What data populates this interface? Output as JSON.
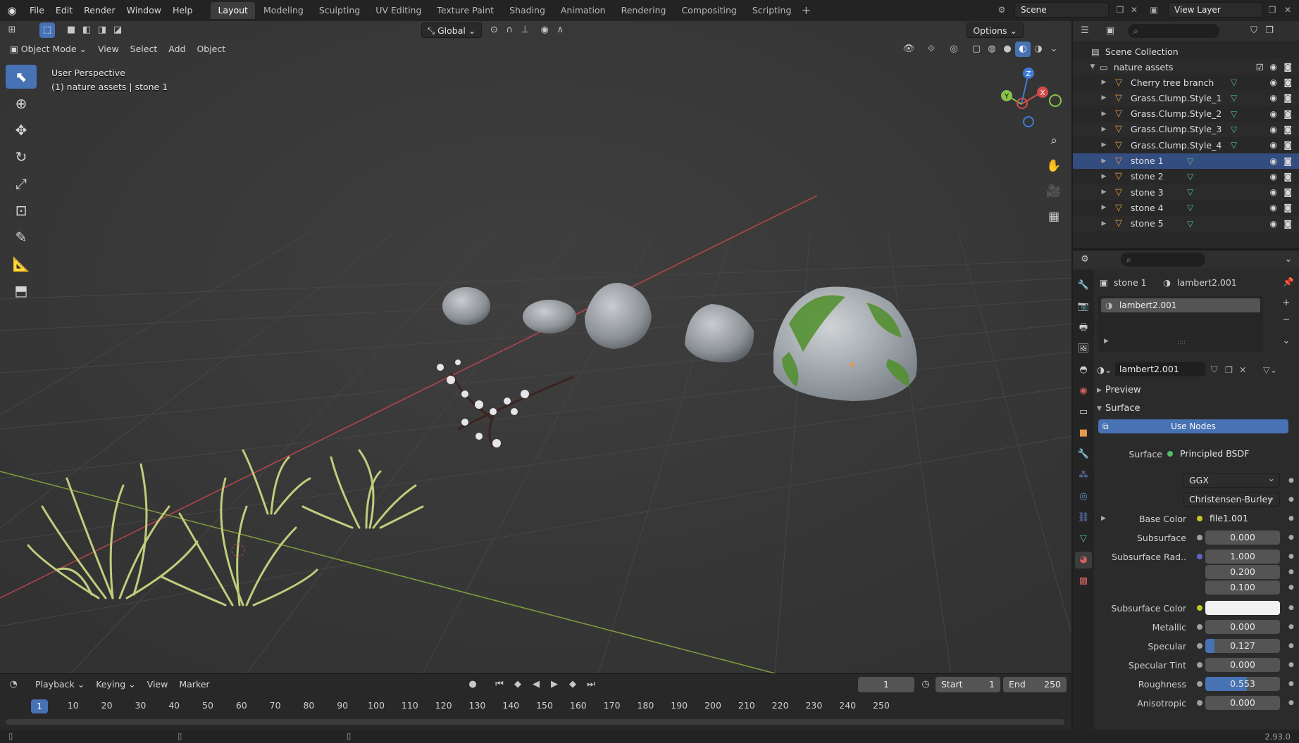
{
  "menu": [
    "File",
    "Edit",
    "Render",
    "Window",
    "Help"
  ],
  "workspaces": [
    "Layout",
    "Modeling",
    "Sculpting",
    "UV Editing",
    "Texture Paint",
    "Shading",
    "Animation",
    "Rendering",
    "Compositing",
    "Scripting"
  ],
  "active_workspace": "Layout",
  "scene_name": "Scene",
  "view_layer_name": "View Layer",
  "viewport": {
    "header": {
      "transform_orientation": "Global",
      "options_label": "Options",
      "mode_label": "Object Mode",
      "menus": [
        "View",
        "Select",
        "Add",
        "Object"
      ]
    },
    "info_line1": "User Perspective",
    "info_line2": "(1) nature assets | stone 1"
  },
  "timeline": {
    "menus": [
      "Playback",
      "Keying",
      "View",
      "Marker"
    ],
    "current_frame": "1",
    "start_label": "Start",
    "start_value": "1",
    "end_label": "End",
    "end_value": "250",
    "ruler_current": "1",
    "ruler_ticks": [
      "10",
      "20",
      "30",
      "40",
      "50",
      "60",
      "70",
      "80",
      "90",
      "100",
      "110",
      "120",
      "130",
      "140",
      "150",
      "160",
      "170",
      "180",
      "190",
      "200",
      "210",
      "220",
      "230",
      "240",
      "250"
    ]
  },
  "statusbar": {
    "version": "2.93.0"
  },
  "outliner": {
    "scene_collection": "Scene Collection",
    "collection": "nature assets",
    "objects": [
      {
        "name": "Cherry tree branch",
        "selected": false
      },
      {
        "name": "Grass.Clump.Style_1",
        "selected": false
      },
      {
        "name": "Grass.Clump.Style_2",
        "selected": false
      },
      {
        "name": "Grass.Clump.Style_3",
        "selected": false
      },
      {
        "name": "Grass.Clump.Style_4",
        "selected": false
      },
      {
        "name": "stone 1",
        "selected": true
      },
      {
        "name": "stone 2",
        "selected": false
      },
      {
        "name": "stone 3",
        "selected": false
      },
      {
        "name": "stone 4",
        "selected": false
      },
      {
        "name": "stone 5",
        "selected": false
      }
    ]
  },
  "properties": {
    "breadcrumb_object": "stone 1",
    "breadcrumb_material": "lambert2.001",
    "slot_name": "lambert2.001",
    "material_name": "lambert2.001",
    "sections": {
      "preview": "Preview",
      "surface": "Surface"
    },
    "use_nodes_label": "Use Nodes",
    "surface_label": "Surface",
    "surface_shader": "Principled BSDF",
    "distribution": "GGX",
    "subsurface_method": "Christensen-Burley",
    "fields": [
      {
        "label": "Base Color",
        "value": "file1.001",
        "socket": "#c7c729",
        "kind": "link"
      },
      {
        "label": "Subsurface",
        "value": "0.000",
        "socket": "#a0a0a0",
        "fill": 0.0
      },
      {
        "label": "Subsurface Rad..",
        "value": "1.000",
        "socket": "#6363c7",
        "fill": 0.0
      },
      {
        "label": "",
        "value": "0.200",
        "fill": 0.0
      },
      {
        "label": "",
        "value": "0.100",
        "fill": 0.0
      },
      {
        "label": "Subsurface Color",
        "value": "",
        "socket": "#c7c729",
        "kind": "color",
        "color": "#f2f2f2"
      },
      {
        "label": "Metallic",
        "value": "0.000",
        "socket": "#a0a0a0",
        "fill": 0.0
      },
      {
        "label": "Specular",
        "value": "0.127",
        "socket": "#a0a0a0",
        "fill": 0.127
      },
      {
        "label": "Specular Tint",
        "value": "0.000",
        "socket": "#a0a0a0",
        "fill": 0.0
      },
      {
        "label": "Roughness",
        "value": "0.553",
        "socket": "#a0a0a0",
        "fill": 0.553
      },
      {
        "label": "Anisotropic",
        "value": "0.000",
        "socket": "#a0a0a0",
        "fill": 0.0
      }
    ]
  },
  "colors": {
    "accent": "#4772b3",
    "object_icon": "#e39a4c",
    "mesh_icon": "#55c07a",
    "x_axis": "#d24c4c",
    "y_axis": "#8ac24b",
    "z_axis": "#3f7bd6"
  }
}
